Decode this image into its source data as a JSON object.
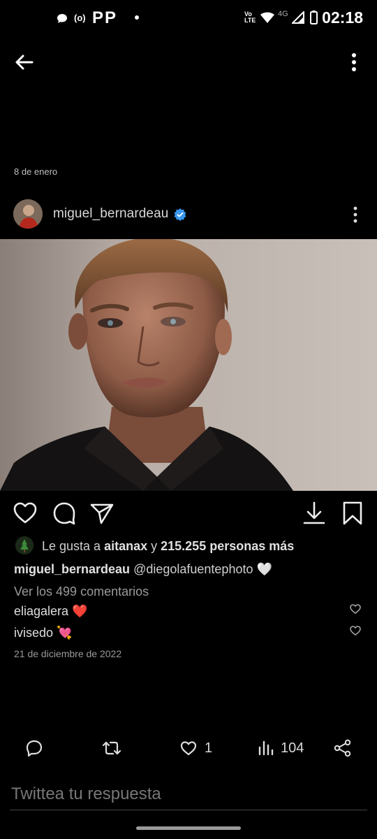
{
  "status_bar": {
    "time": "02:18",
    "network": "4G"
  },
  "post": {
    "date": "8 de enero",
    "username": "miguel_bernardeau",
    "likes": {
      "prefix": "Le gusta a ",
      "user": "aitanax",
      "mid": " y ",
      "count": "215.255 personas más"
    },
    "caption": {
      "username": "miguel_bernardeau",
      "text": " @diegolafuentephoto 🤍"
    },
    "view_comments": "Ver los 499 comentarios",
    "comments": [
      {
        "user": "eliagalera",
        "emoji": "❤️"
      },
      {
        "user": "ivisedo",
        "emoji": "💘"
      }
    ],
    "timestamp": "21 de diciembre de 2022"
  },
  "tweet_actions": {
    "likes": "1",
    "views": "104"
  },
  "reply": {
    "placeholder": "Twittea tu respuesta"
  },
  "colors": {
    "background": "#000000",
    "verified": "#3897f0",
    "heart_red": "#e0245e"
  }
}
